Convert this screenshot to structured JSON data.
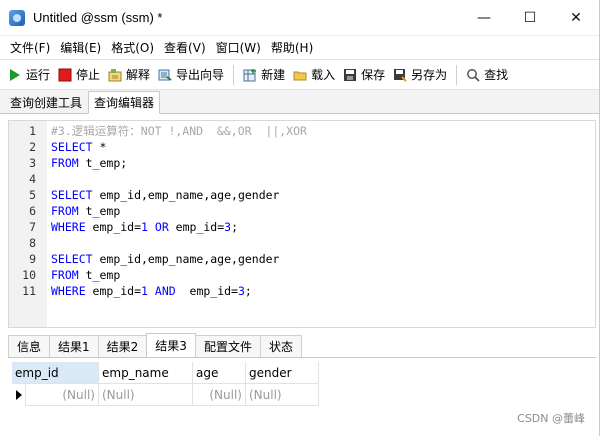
{
  "window": {
    "title": "Untitled @ssm (ssm) *",
    "minimize": "—",
    "maximize": "☐",
    "close": "✕"
  },
  "menu": [
    "文件(F)",
    "编辑(E)",
    "格式(O)",
    "查看(V)",
    "窗口(W)",
    "帮助(H)"
  ],
  "toolbar": {
    "run": "运行",
    "stop": "停止",
    "explain": "解释",
    "export_wizard": "导出向导",
    "new": "新建",
    "load": "载入",
    "save": "保存",
    "save_as": "另存为",
    "find": "查找"
  },
  "top_tabs": [
    "查询创建工具",
    "查询编辑器"
  ],
  "editor": {
    "line_numbers": [
      "1",
      "2",
      "3",
      "4",
      "5",
      "6",
      "7",
      "8",
      "9",
      "10",
      "11"
    ],
    "l1_comment": "#3.逻辑运算符：NOT !,AND  &&,OR  ||,XOR",
    "l2_kw": "SELECT",
    "l2_rest": " *",
    "l3_kw": "FROM",
    "l3_rest": " t_emp;",
    "l5_kw": "SELECT",
    "l5_rest": " emp_id,emp_name,age,gender",
    "l6_kw": "FROM",
    "l6_rest": " t_emp",
    "l7_kw": "WHERE",
    "l7_a": " emp_id=",
    "l7_n1": "1",
    "l7_or": "OR",
    "l7_b": " emp_id=",
    "l7_n2": "3",
    "l7_end": ";",
    "l9_kw": "SELECT",
    "l9_rest": " emp_id,emp_name,age,gender",
    "l10_kw": "FROM",
    "l10_rest": " t_emp",
    "l11_kw": "WHERE",
    "l11_a": " emp_id=",
    "l11_n1": "1",
    "l11_and": "AND",
    "l11_b": "  emp_id=",
    "l11_n2": "3",
    "l11_end": ";"
  },
  "result_tabs": [
    "信息",
    "结果1",
    "结果2",
    "结果3",
    "配置文件",
    "状态"
  ],
  "grid": {
    "columns": [
      "emp_id",
      "emp_name",
      "age",
      "gender"
    ],
    "row": [
      "(Null)",
      "(Null)",
      "(Null)",
      "(Null)"
    ]
  },
  "watermark": "CSDN @蕾峰"
}
